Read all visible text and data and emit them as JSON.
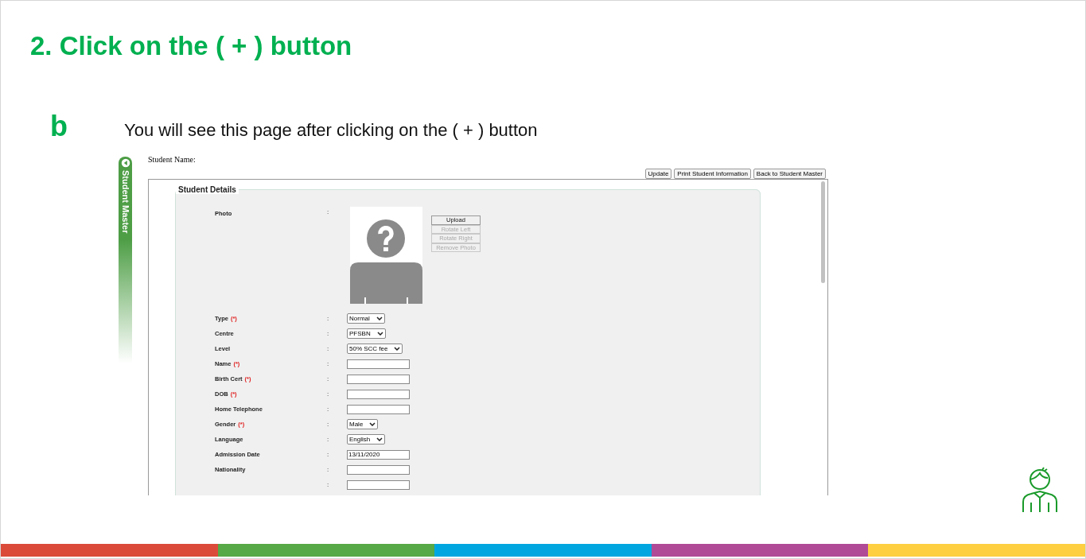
{
  "slide": {
    "title": "2. Click on the ( + ) button",
    "step": "b",
    "caption": "You will see this page after clicking on the ( + ) button"
  },
  "screen": {
    "side_tab": "Student Master",
    "student_name_label": "Student Name:",
    "toolbar": [
      "Update",
      "Print Student Information",
      "Back to Student Master"
    ],
    "section_title": "Student Details",
    "photo": {
      "label": "Photo",
      "separator": ":",
      "buttons": [
        {
          "label": "Upload",
          "disabled": false
        },
        {
          "label": "Rotate Left",
          "disabled": true
        },
        {
          "label": "Rotate Right",
          "disabled": true
        },
        {
          "label": "Remove Photo",
          "disabled": true
        }
      ]
    },
    "fields": [
      {
        "label": "Type",
        "mark": "(*)",
        "separator": ":",
        "kind": "select",
        "value": "Normal"
      },
      {
        "label": "Centre",
        "separator": ":",
        "kind": "select",
        "value": "PFSBN"
      },
      {
        "label": "Level",
        "separator": ":",
        "kind": "select",
        "value": "50% SCC fee"
      },
      {
        "label": "Name",
        "mark": "(*)",
        "separator": ":",
        "kind": "text"
      },
      {
        "label": "Birth Cert",
        "mark": "(*)",
        "separator": ":",
        "kind": "text"
      },
      {
        "label": "DOB",
        "mark": "(*)",
        "separator": ":",
        "kind": "text"
      },
      {
        "label": "Home Telephone",
        "separator": ":",
        "kind": "text"
      },
      {
        "label": "Gender",
        "mark": "(*)",
        "separator": ":",
        "kind": "select",
        "value": "Male"
      },
      {
        "label": "Language",
        "separator": ":",
        "kind": "select",
        "value": "English"
      },
      {
        "label": "Admission Date",
        "separator": ":",
        "kind": "text",
        "value": "13/11/2020"
      },
      {
        "label": "Nationality",
        "separator": ":",
        "kind": "text"
      },
      {
        "separator": ":",
        "kind": "text"
      }
    ]
  }
}
